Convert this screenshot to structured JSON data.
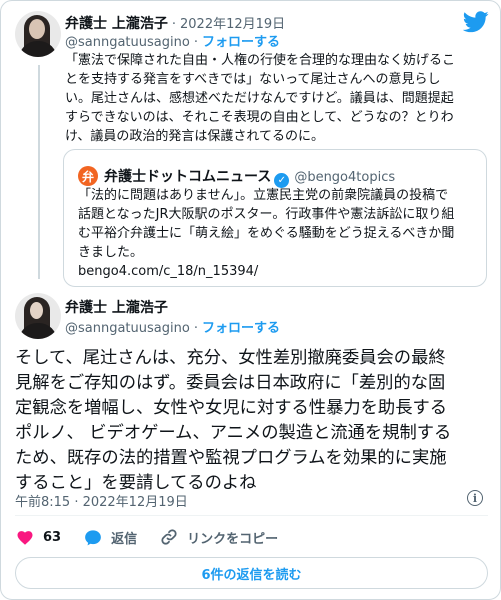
{
  "colors": {
    "accent": "#1d9bf0",
    "like": "#f91880",
    "muted": "#536471",
    "brand_quote": "#f26522"
  },
  "tweet1": {
    "author_name": "弁護士 上瀧浩子",
    "separator": "·",
    "date": "2022年12月19日",
    "handle": "@sanngatuusagino",
    "follow_label": "フォローする",
    "lines": [
      "「憲法で保障された自由・人権の行使を合理的な理由なく妨げるこ",
      "とを支持する発言をすべきでは」ないって尾辻さんへの意見らし",
      "い。尾辻さんは、感想述べただけなんですけど。議員は、問題提起",
      "すらできないのは、それこそ表現の自由として、どうなの？とりわ",
      "け、議員の政治的発言は保護されてるのに。"
    ]
  },
  "quote": {
    "avatar_glyph": "弁",
    "name": "弁護士ドットコムニュース",
    "verified_glyph": "✓",
    "handle": "@bengo4topics",
    "lines": [
      "「法的に問題はありません」。立憲民主党の前衆院議員の投稿で",
      "話題となったJR大阪駅のポスター。行政事件や憲法訴訟に取り組",
      "む平裕介弁護士に「萌え絵」をめぐる騒動をどう捉えるべきか聞",
      "きました。"
    ],
    "link": "bengo4.com/c_18/n_15394/"
  },
  "tweet2": {
    "author_name": "弁護士 上瀧浩子",
    "handle": "@sanngatuusagino",
    "separator": "·",
    "follow_label": "フォローする",
    "lines": [
      "そして、尾辻さんは、充分、女性差別撤廃委員会の最終",
      "見解をご存知のはず。委員会は日本政府に「差別的な固",
      "定観念を増幅し、女性や女児に対する性暴力を助長する",
      "ポルノ、 ビデオゲーム、アニメの製造と流通を規制する",
      "ため、既存の法的措置や監視プログラムを効果的に実施",
      "すること」を要請してるのよね"
    ],
    "timestamp": "午前8:15 · 2022年12月19日",
    "info_glyph": "i"
  },
  "actions": {
    "like_count": "63",
    "reply_label": "返信",
    "copy_link_label": "リンクをコピー"
  },
  "read_replies_label": "6件の返信を読む",
  "icons": [
    "twitter-bird-icon",
    "verified-badge-icon",
    "info-icon",
    "heart-icon",
    "reply-bubble-icon",
    "link-icon"
  ]
}
